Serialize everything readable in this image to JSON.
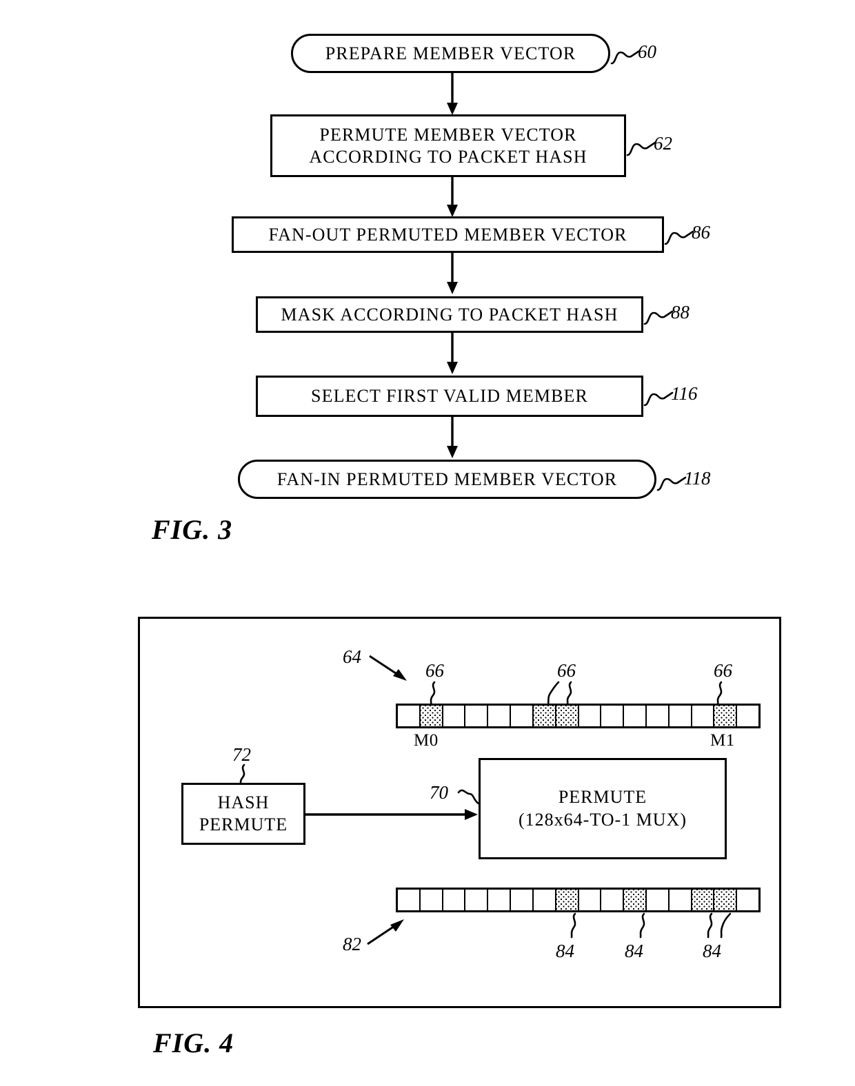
{
  "document": {
    "kind": "patent-figure-sheet",
    "background_color": "#ffffff",
    "ink_color": "#000000"
  },
  "figures": [
    {
      "caption": "FIG. 3",
      "type": "flowchart",
      "nodes": [
        {
          "id": "n60",
          "ref": "60",
          "shape": "terminator",
          "text": "PREPARE MEMBER VECTOR"
        },
        {
          "id": "n62",
          "ref": "62",
          "shape": "process",
          "line1": "PERMUTE MEMBER VECTOR",
          "line2": "ACCORDING TO PACKET HASH"
        },
        {
          "id": "n86",
          "ref": "86",
          "shape": "process",
          "text": "FAN-OUT PERMUTED MEMBER VECTOR"
        },
        {
          "id": "n88",
          "ref": "88",
          "shape": "process",
          "text": "MASK ACCORDING TO PACKET HASH"
        },
        {
          "id": "n116",
          "ref": "116",
          "shape": "process",
          "text": "SELECT FIRST VALID MEMBER"
        },
        {
          "id": "n118",
          "ref": "118",
          "shape": "terminator",
          "text": "FAN-IN PERMUTED MEMBER VECTOR"
        }
      ],
      "edges": [
        {
          "from": "n60",
          "to": "n62"
        },
        {
          "from": "n62",
          "to": "n86"
        },
        {
          "from": "n86",
          "to": "n88"
        },
        {
          "from": "n88",
          "to": "n116"
        },
        {
          "from": "n116",
          "to": "n118"
        }
      ]
    },
    {
      "caption": "FIG. 4",
      "type": "block-diagram",
      "panel_border": true,
      "input_vector": {
        "ref": "64",
        "cell_count": 16,
        "filled_cells": [
          1,
          6,
          7,
          14
        ],
        "cell_refs": [
          "66",
          "66",
          "66"
        ],
        "cell_labels": [
          {
            "index": 1,
            "label": "M0"
          },
          {
            "index": 14,
            "label": "M1"
          }
        ]
      },
      "hash_block": {
        "ref": "72",
        "line1": "HASH",
        "line2": "PERMUTE"
      },
      "permute_block": {
        "ref": "70",
        "line1": "PERMUTE",
        "line2": "(128x64-TO-1 MUX)"
      },
      "output_vector": {
        "ref": "82",
        "cell_count": 16,
        "filled_cells": [
          7,
          10,
          13,
          14
        ],
        "cell_refs": [
          "84",
          "84",
          "84"
        ]
      }
    }
  ]
}
